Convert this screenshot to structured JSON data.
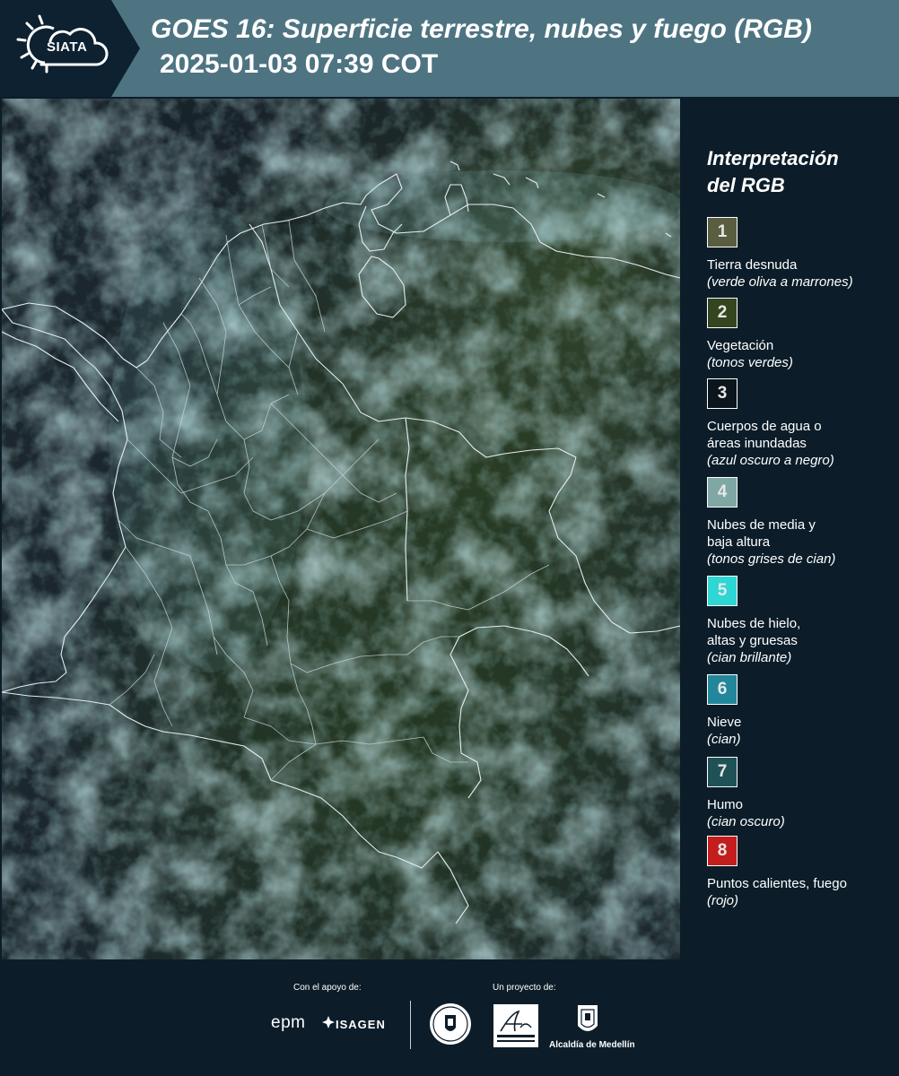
{
  "header": {
    "logo_text": "SIATA",
    "title": "GOES 16: Superficie terrestre, nubes y fuego (RGB)",
    "datetime": "2025-01-03 07:39 COT"
  },
  "legend": {
    "title_line1": "Interpretación",
    "title_line2": "del RGB",
    "items": [
      {
        "number": "1",
        "color": "#5a5e40",
        "label_lines": [
          "Tierra desnuda"
        ],
        "desc": "(verde oliva a marrones)"
      },
      {
        "number": "2",
        "color": "#34451f",
        "label_lines": [
          "Vegetación"
        ],
        "desc": "(tonos verdes)"
      },
      {
        "number": "3",
        "color": "#0b151c",
        "label_lines": [
          "Cuerpos de agua o",
          "áreas inundadas"
        ],
        "desc": "(azul oscuro a negro)"
      },
      {
        "number": "4",
        "color": "#7fa7a3",
        "label_lines": [
          "Nubes de media y",
          "baja altura"
        ],
        "desc": "(tonos grises de cian)"
      },
      {
        "number": "5",
        "color": "#2ed6d4",
        "label_lines": [
          "Nubes de hielo,",
          "altas y gruesas"
        ],
        "desc": "(cian brillante)"
      },
      {
        "number": "6",
        "color": "#22879a",
        "label_lines": [
          "Nieve"
        ],
        "desc": "(cian)"
      },
      {
        "number": "7",
        "color": "#1f5256",
        "label_lines": [
          "Humo"
        ],
        "desc": "(cian oscuro)"
      },
      {
        "number": "8",
        "color": "#c41d1d",
        "label_lines": [
          "Puntos calientes, fuego"
        ],
        "desc": "(rojo)"
      }
    ]
  },
  "footer": {
    "support_label": "Con el apoyo de:",
    "project_label": "Un proyecto de:",
    "epm": "epm",
    "isagen": "ISAGEN",
    "alcaldia": "Alcaldía de Medellín"
  }
}
